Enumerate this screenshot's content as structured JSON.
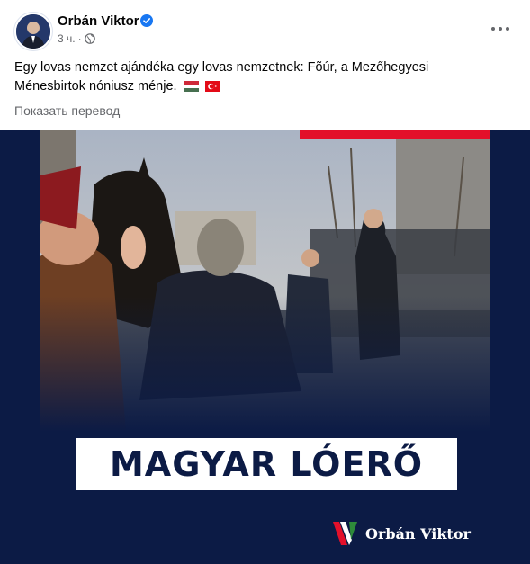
{
  "post": {
    "author": "Orbán Viktor",
    "time": "3 ч.",
    "separator": "·",
    "audience_icon": "globe-icon",
    "body_text": "Egy lovas nemzet ajándéka egy lovas nemzetnek: Fõúr, a Mezőhegyesi Ménesbirtok nóniusz ménje.",
    "flags": [
      "hungary-flag",
      "turkey-flag"
    ],
    "translate_label": "Показать перевод"
  },
  "media": {
    "banner_text": "MAGYAR LÓERŐ",
    "brand_name": "Orbán Viktor"
  },
  "colors": {
    "accent_blue": "#1877f2",
    "navy": "#0c1b45",
    "red": "#e3102a",
    "green": "#2e8b3a",
    "secondary_text": "#65676b"
  }
}
